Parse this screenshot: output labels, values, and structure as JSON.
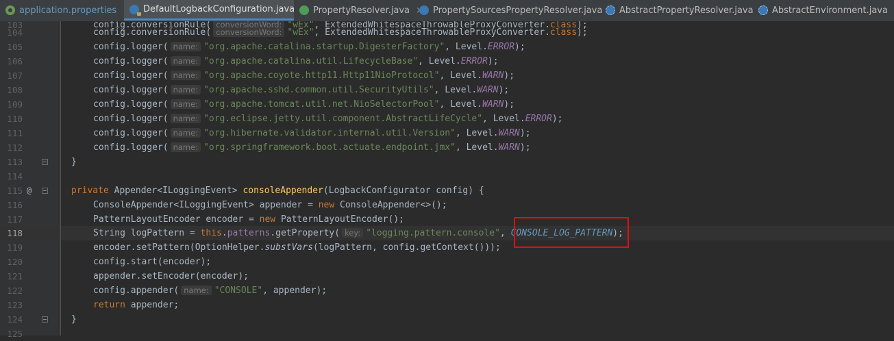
{
  "tabs": [
    {
      "label": "application.properties",
      "icon": "spring-properties-icon",
      "active": false
    },
    {
      "label": "DefaultLogbackConfiguration.java",
      "icon": "java-class-icon",
      "active": true
    },
    {
      "label": "PropertyResolver.java",
      "icon": "interface-icon",
      "active": false
    },
    {
      "label": "PropertySourcesPropertyResolver.java",
      "icon": "java-class-icon",
      "active": false
    },
    {
      "label": "AbstractPropertyResolver.java",
      "icon": "abstract-class-icon",
      "active": false
    },
    {
      "label": "AbstractEnvironment.java",
      "icon": "abstract-class-icon",
      "active": false
    }
  ],
  "close_glyph": "×",
  "gutter": {
    "line_numbers": [
      "103",
      "104",
      "105",
      "106",
      "107",
      "108",
      "109",
      "110",
      "111",
      "112",
      "113",
      "114",
      "115",
      "116",
      "117",
      "118",
      "119",
      "120",
      "121",
      "122",
      "123",
      "124",
      "125"
    ],
    "current_line": "118",
    "annotation_marker": "@"
  },
  "code": {
    "l103": {
      "a": "config.conversionRule(",
      "hint": "conversionWord:",
      "str": "\"wEx\"",
      "rest": ", ExtendedWhitespaceThrowableProxyConverter.",
      "kw": "class",
      "end": ");"
    },
    "l104": {
      "a": "config.conversionRule(",
      "hint": "conversionWord:",
      "str": "\"wEx\"",
      "rest": ", ExtendedWhitespaceThrowableProxyConverter.",
      "kw": "class",
      "end": ");"
    },
    "l105": {
      "a": "config.logger(",
      "hint": "name:",
      "str": "\"org.apache.catalina.startup.DigesterFactory\"",
      "rest": ", Level.",
      "cst": "ERROR",
      "end": ");"
    },
    "l106": {
      "a": "config.logger(",
      "hint": "name:",
      "str": "\"org.apache.catalina.util.LifecycleBase\"",
      "rest": ", Level.",
      "cst": "ERROR",
      "end": ");"
    },
    "l107": {
      "a": "config.logger(",
      "hint": "name:",
      "str": "\"org.apache.coyote.http11.Http11NioProtocol\"",
      "rest": ", Level.",
      "cst": "WARN",
      "end": ");"
    },
    "l108": {
      "a": "config.logger(",
      "hint": "name:",
      "str": "\"org.apache.sshd.common.util.SecurityUtils\"",
      "rest": ", Level.",
      "cst": "WARN",
      "end": ");"
    },
    "l109": {
      "a": "config.logger(",
      "hint": "name:",
      "str": "\"org.apache.tomcat.util.net.NioSelectorPool\"",
      "rest": ", Level.",
      "cst": "WARN",
      "end": ");"
    },
    "l110": {
      "a": "config.logger(",
      "hint": "name:",
      "str": "\"org.eclipse.jetty.util.component.AbstractLifeCycle\"",
      "rest": ", Level.",
      "cst": "ERROR",
      "end": ");"
    },
    "l111": {
      "a": "config.logger(",
      "hint": "name:",
      "str": "\"org.hibernate.validator.internal.util.Version\"",
      "rest": ", Level.",
      "cst": "WARN",
      "end": ");"
    },
    "l112": {
      "a": "config.logger(",
      "hint": "name:",
      "str": "\"org.springframework.boot.actuate.endpoint.jmx\"",
      "rest": ", Level.",
      "cst": "WARN",
      "end": ");"
    },
    "l113": {
      "a": "}"
    },
    "l115": {
      "kw": "private",
      "a": " Appender<ILoggingEvent> ",
      "fn": "consoleAppender",
      "rest": "(LogbackConfigurator config) {"
    },
    "l116": {
      "a": "ConsoleAppender<ILoggingEvent> appender = ",
      "kw": "new",
      "rest": " ConsoleAppender<>();"
    },
    "l117": {
      "a": "PatternLayoutEncoder encoder = ",
      "kw": "new",
      "rest": " PatternLayoutEncoder();"
    },
    "l118": {
      "a": "String logPattern = ",
      "kw": "this",
      "dot": ".",
      "fld": "patterns",
      "b": ".getProperty(",
      "hint": "key:",
      "str": "\"logging.pattern.console\"",
      "comma": ", ",
      "lnk": "CONSOLE_LOG_PATTERN",
      "end": ");"
    },
    "l119": {
      "a": "encoder.setPattern(OptionHelper.",
      "ital": "substVars",
      "rest": "(logPattern, config.getContext()));"
    },
    "l120": {
      "a": "config.start(encoder);"
    },
    "l121": {
      "a": "appender.setEncoder(encoder);"
    },
    "l122": {
      "a": "config.appender(",
      "hint": "name:",
      "str": "\"CONSOLE\"",
      "rest": ", appender);"
    },
    "l123": {
      "kw": "return",
      "a": " appender;"
    },
    "l124": {
      "a": "}"
    }
  }
}
